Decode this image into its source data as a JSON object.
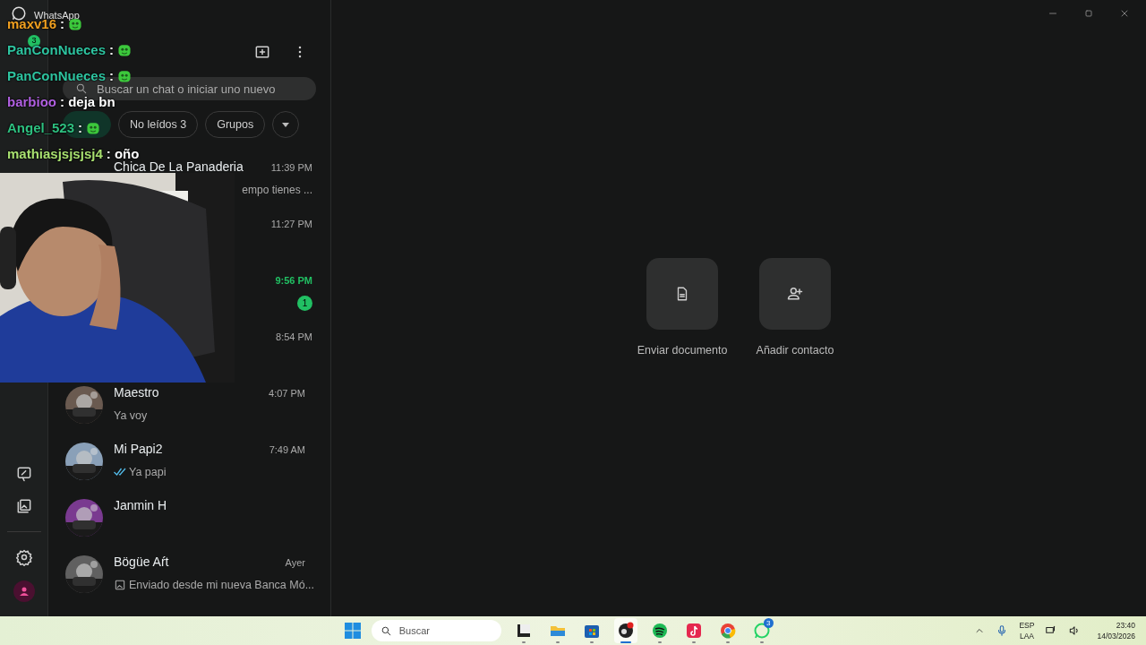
{
  "window": {
    "title": "WhatsApp"
  },
  "rail": {
    "chats_badge": "3"
  },
  "search": {
    "placeholder": "Buscar un chat o iniciar uno nuevo"
  },
  "filters": [
    {
      "selected": true,
      "kind": "chip"
    },
    {
      "label": "No leídos 3",
      "selected": false,
      "kind": "chip"
    },
    {
      "label": "Grupos",
      "selected": false,
      "kind": "chip"
    },
    {
      "selected": false,
      "kind": "dropdown"
    }
  ],
  "chats": [
    {
      "kind": "covered",
      "name": "Chica De La Panaderia",
      "time": "11:39 PM",
      "preview": "empo tienes ..."
    },
    {
      "kind": "covered",
      "time": "11:27 PM"
    },
    {
      "kind": "covered",
      "time": "9:56 PM",
      "unread": "1"
    },
    {
      "kind": "covered",
      "time": "8:54 PM"
    },
    {
      "kind": "full",
      "name": "Maestro",
      "time": "4:07 PM",
      "preview": "Ya voy"
    },
    {
      "kind": "full",
      "name": "Mi Papi2",
      "time": "7:49 AM",
      "preview": "Ya papi",
      "read_ticks": true
    },
    {
      "kind": "full",
      "name": "Janmin H"
    },
    {
      "kind": "full",
      "name": "Bögüe Aŕt",
      "time": "Ayer",
      "preview": "Enviado desde mi nueva Banca Mó...",
      "has_image": true
    }
  ],
  "actions": [
    {
      "label": "Enviar documento",
      "kind": "document"
    },
    {
      "label": "Añadir contacto",
      "kind": "contact"
    }
  ],
  "overlay_chat": [
    {
      "user": "maxv16",
      "color": "#f0a020",
      "kind": "emote",
      "text": ":"
    },
    {
      "user": "PanConNueces",
      "color": "#2ec4a0",
      "kind": "emote",
      "text": ":"
    },
    {
      "user": "PanConNueces",
      "color": "#2ec4a0",
      "kind": "emote",
      "text": ":"
    },
    {
      "user": "barbioo",
      "color": "#b060e0",
      "kind": "text",
      "text": ": deja bn"
    },
    {
      "user": "Angel_523",
      "color": "#2ec080",
      "kind": "emote",
      "text": ":"
    },
    {
      "user": "mathiasjsjsjsj4",
      "color": "#a8e070",
      "kind": "text",
      "text": ": oño"
    }
  ],
  "taskbar": {
    "search_placeholder": "Buscar",
    "apps": [
      {
        "kind": "explorer-dark",
        "selected": false
      },
      {
        "kind": "folder",
        "selected": false
      },
      {
        "kind": "store",
        "selected": false
      },
      {
        "kind": "obs",
        "selected": true
      },
      {
        "kind": "spotify",
        "selected": false
      },
      {
        "kind": "tiktok",
        "selected": false
      },
      {
        "kind": "chrome",
        "selected": false
      },
      {
        "kind": "whatsapp",
        "selected": false,
        "badge": "3"
      }
    ],
    "language": "ESP",
    "layout": "LAA",
    "time": "23:40",
    "date": "14/03/2026"
  }
}
